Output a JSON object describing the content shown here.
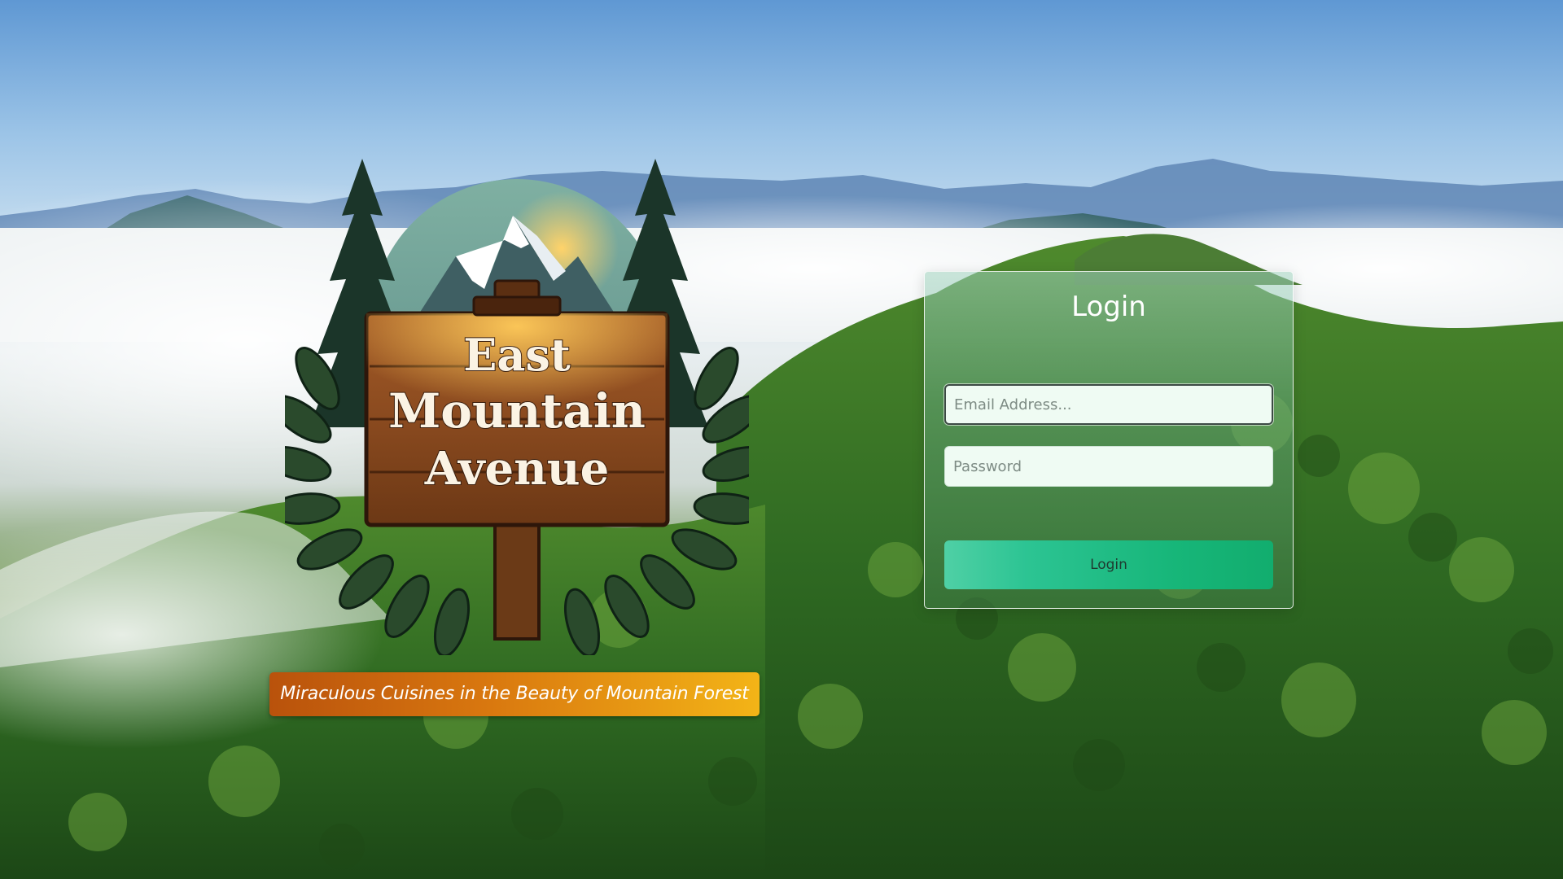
{
  "branding": {
    "logo_line1": "East",
    "logo_line2": "Mountain",
    "logo_line3": "Avenue",
    "tagline": "Miraculous Cuisines in the Beauty of Mountain Forest"
  },
  "login": {
    "title": "Login",
    "email_placeholder": "Email Address...",
    "password_placeholder": "Password",
    "submit_label": "Login"
  },
  "colors": {
    "tagline_start": "#b9520c",
    "tagline_end": "#f3b417",
    "button_start": "#4fd0a5",
    "button_end": "#12ad6e"
  }
}
